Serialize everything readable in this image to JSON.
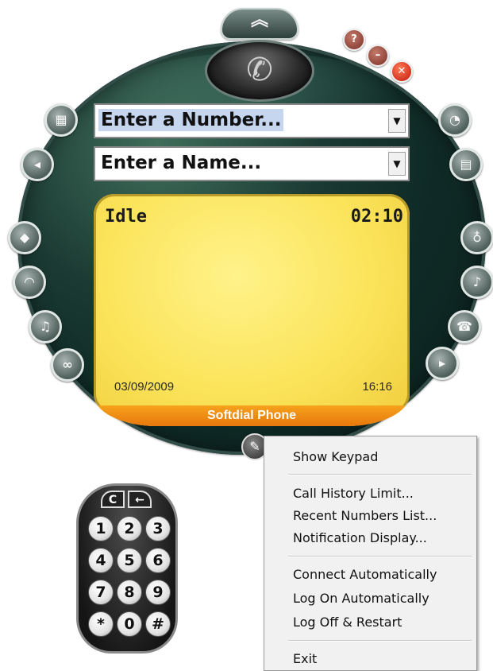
{
  "window_controls": {
    "help_glyph": "?",
    "minimize_glyph": "–",
    "close_glyph": "✕"
  },
  "top_tab_glyph": "︽",
  "handset_glyph": "✆",
  "number_combo": {
    "value": "Enter a Number..."
  },
  "name_combo": {
    "value": "Enter a Name..."
  },
  "combo_arrow": "▼",
  "display": {
    "status": "Idle",
    "timer": "02:10",
    "date": "03/09/2009",
    "time": "16:16",
    "footer": "Softdial Phone"
  },
  "left_buttons": [
    "keypad-show-icon",
    "keypad-hide-icon",
    "diamond-icon",
    "headset-icon",
    "speaker-icon",
    "voicemail-icon"
  ],
  "right_buttons": [
    "call-history-icon",
    "contacts-icon",
    "microphone-icon",
    "music-icon",
    "conference-icon",
    "transfer-icon"
  ],
  "keypad": {
    "clear": "C",
    "back": "←",
    "keys": [
      "1",
      "2",
      "3",
      "4",
      "5",
      "6",
      "7",
      "8",
      "9",
      "*",
      "0",
      "#"
    ]
  },
  "context_menu": {
    "items": [
      "Show Keypad",
      "Call History Limit...",
      "Recent Numbers List...",
      "Notification Display...",
      "Connect Automatically",
      "Log On Automatically",
      "Log Off & Restart",
      "Exit"
    ]
  }
}
